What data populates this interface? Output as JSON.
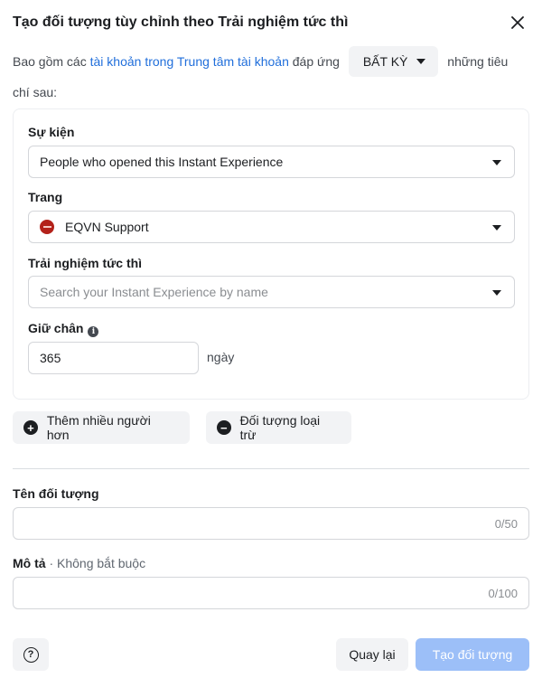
{
  "dialog": {
    "title": "Tạo đối tượng tùy chỉnh theo Trải nghiệm tức thì"
  },
  "intro": {
    "prefix": "Bao gồm các",
    "link": "tài khoản trong Trung tâm tài khoản",
    "middle": "đáp ứng",
    "match_value": "BẤT KỲ",
    "suffix": "những tiêu chí sau:"
  },
  "criteria": {
    "event_label": "Sự kiện",
    "event_value": "People who opened this Instant Experience",
    "page_label": "Trang",
    "page_value": "EQVN Support",
    "instant_label": "Trải nghiệm tức thì",
    "instant_placeholder": "Search your Instant Experience by name",
    "retention_label": "Giữ chân",
    "retention_info": "i",
    "retention_value": "365",
    "retention_unit": "ngày"
  },
  "actions": {
    "include_more": "Thêm nhiều người hơn",
    "include_icon": "+",
    "exclude": "Đối tượng loại trừ",
    "exclude_icon": "−"
  },
  "name_field": {
    "label": "Tên đối tượng",
    "value": "",
    "counter": "0/50"
  },
  "description_field": {
    "label": "Mô tả",
    "optional": "· Không bắt buộc",
    "value": "",
    "counter": "0/100"
  },
  "footer": {
    "help_symbol": "?",
    "back_label": "Quay lại",
    "create_label": "Tạo đối tượng"
  },
  "colors": {
    "link": "#216fdb",
    "primary_disabled": "#9cbff8",
    "page_avatar": "#b3211a"
  }
}
